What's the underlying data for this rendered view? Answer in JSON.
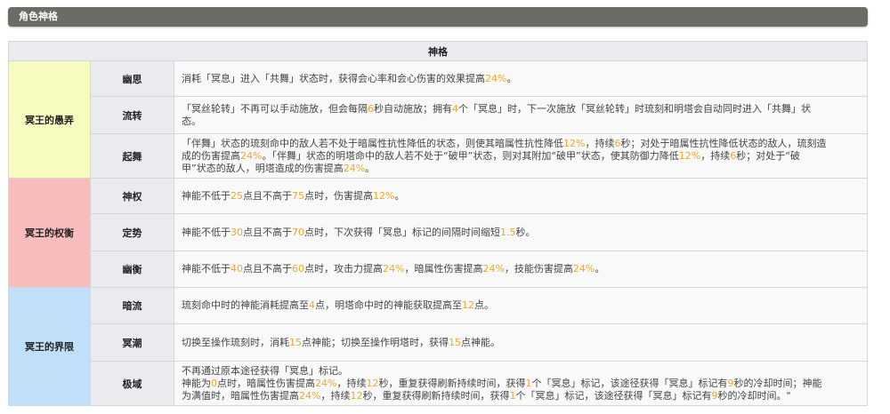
{
  "section_title": "角色神格",
  "table_title": "神格",
  "colors": {
    "header_bg": "#6d6b66",
    "highlight": "#f5a623",
    "group_yellow": "#f8fbc0",
    "group_red": "#f8bcbc",
    "group_blue": "#bfe0f8"
  },
  "groups": [
    {
      "name": "冥王的愚弄",
      "color": "#f8fbc0",
      "rows": [
        {
          "name": "幽思",
          "height": 40,
          "lines": [
            [
              {
                "t": "消耗「冥息」进入「共舞」状态时，获得会心率和会心伤害的效果提高"
              },
              {
                "t": "24%",
                "h": true
              },
              {
                "t": "。"
              }
            ]
          ]
        },
        {
          "name": "流转",
          "height": 42,
          "lines": [
            [
              {
                "t": "「冥丝轮转」不再可以手动施放，但会每隔"
              },
              {
                "t": "6",
                "h": true
              },
              {
                "t": "秒自动施放；拥有"
              },
              {
                "t": "4",
                "h": true
              },
              {
                "t": "个「冥息」时，下一次施放「冥丝轮转」时琉刻和明塔会自动同时进入「共舞」状"
              }
            ],
            [
              {
                "t": "态。"
              }
            ]
          ]
        },
        {
          "name": "起舞",
          "height": 50,
          "lines": [
            [
              {
                "t": "「伴舞」状态的琉刻命中的敌人若不处于暗属性抗性降低的状态，则使其暗属性抗性降低"
              },
              {
                "t": "12%",
                "h": true
              },
              {
                "t": "，持续"
              },
              {
                "t": "6",
                "h": true
              },
              {
                "t": "秒；对处于暗属性抗性降低状态的敌人，琉刻造"
              }
            ],
            [
              {
                "t": "成的伤害提高"
              },
              {
                "t": "24%",
                "h": true
              },
              {
                "t": "。「伴舞」状态的明塔命中的敌人若不处于“破甲”状态，则对其附加“破甲”状态，使其防御力降低"
              },
              {
                "t": "12%",
                "h": true
              },
              {
                "t": "，持续"
              },
              {
                "t": "6",
                "h": true
              },
              {
                "t": "秒；对处于“破"
              }
            ],
            [
              {
                "t": "甲”状态的敌人，明塔造成的伤害提高"
              },
              {
                "t": "24%",
                "h": true
              },
              {
                "t": "。"
              }
            ]
          ]
        }
      ]
    },
    {
      "name": "冥王的权衡",
      "color": "#f8bcbc",
      "rows": [
        {
          "name": "神权",
          "height": 40,
          "lines": [
            [
              {
                "t": "神能不低于"
              },
              {
                "t": "25",
                "h": true
              },
              {
                "t": "点且不高于"
              },
              {
                "t": "75",
                "h": true
              },
              {
                "t": "点时，伤害提高"
              },
              {
                "t": "12%",
                "h": true
              },
              {
                "t": "。"
              }
            ]
          ]
        },
        {
          "name": "定势",
          "height": 42,
          "lines": [
            [
              {
                "t": "神能不低于"
              },
              {
                "t": "30",
                "h": true
              },
              {
                "t": "点且不高于"
              },
              {
                "t": "70",
                "h": true
              },
              {
                "t": "点时，下次获得「冥息」标记的间隔时间缩短"
              },
              {
                "t": "1.5",
                "h": true
              },
              {
                "t": "秒。"
              }
            ]
          ]
        },
        {
          "name": "幽衡",
          "height": 41,
          "lines": [
            [
              {
                "t": "神能不低于"
              },
              {
                "t": "40",
                "h": true
              },
              {
                "t": "点且不高于"
              },
              {
                "t": "60",
                "h": true
              },
              {
                "t": "点时，攻击力提高"
              },
              {
                "t": "24%",
                "h": true
              },
              {
                "t": "，暗属性伤害提高"
              },
              {
                "t": "24%",
                "h": true
              },
              {
                "t": "，技能伤害提高"
              },
              {
                "t": "24%",
                "h": true
              },
              {
                "t": "。"
              }
            ]
          ]
        }
      ]
    },
    {
      "name": "冥王的界限",
      "color": "#bfe0f8",
      "rows": [
        {
          "name": "暗流",
          "height": 41,
          "lines": [
            [
              {
                "t": "琉刻命中时的神能消耗提高至"
              },
              {
                "t": "4",
                "h": true
              },
              {
                "t": "点，明塔命中时的神能获取提高至"
              },
              {
                "t": "12",
                "h": true
              },
              {
                "t": "点。"
              }
            ]
          ]
        },
        {
          "name": "冥潮",
          "height": 42,
          "lines": [
            [
              {
                "t": "切换至操作琉刻时，消耗"
              },
              {
                "t": "15",
                "h": true
              },
              {
                "t": "点神能；切换至操作明塔时，获得"
              },
              {
                "t": "15",
                "h": true
              },
              {
                "t": "点神能。"
              }
            ]
          ]
        },
        {
          "name": "极域",
          "height": 50,
          "lines": [
            [
              {
                "t": "不再通过原本途径获得「冥息」标记。"
              }
            ],
            [
              {
                "t": "神能为"
              },
              {
                "t": "0",
                "h": true
              },
              {
                "t": "点时，暗属性伤害提高"
              },
              {
                "t": "24%",
                "h": true
              },
              {
                "t": "，持续"
              },
              {
                "t": "12",
                "h": true
              },
              {
                "t": "秒，重复获得刷新持续时间，获得"
              },
              {
                "t": "1",
                "h": true
              },
              {
                "t": "个「冥息」标记，该途径获得「冥息」标记有"
              },
              {
                "t": "9",
                "h": true
              },
              {
                "t": "秒的冷却时间；神能"
              }
            ],
            [
              {
                "t": "为满值时，暗属性伤害提高"
              },
              {
                "t": "24%",
                "h": true
              },
              {
                "t": "，持续"
              },
              {
                "t": "12",
                "h": true
              },
              {
                "t": "秒，重复获得刷新持续时间，获得"
              },
              {
                "t": "1",
                "h": true
              },
              {
                "t": "个「冥息」标记，该途径获得「冥息」标记有"
              },
              {
                "t": "9",
                "h": true
              },
              {
                "t": "秒的冷却时间。\""
              }
            ]
          ]
        }
      ]
    }
  ]
}
